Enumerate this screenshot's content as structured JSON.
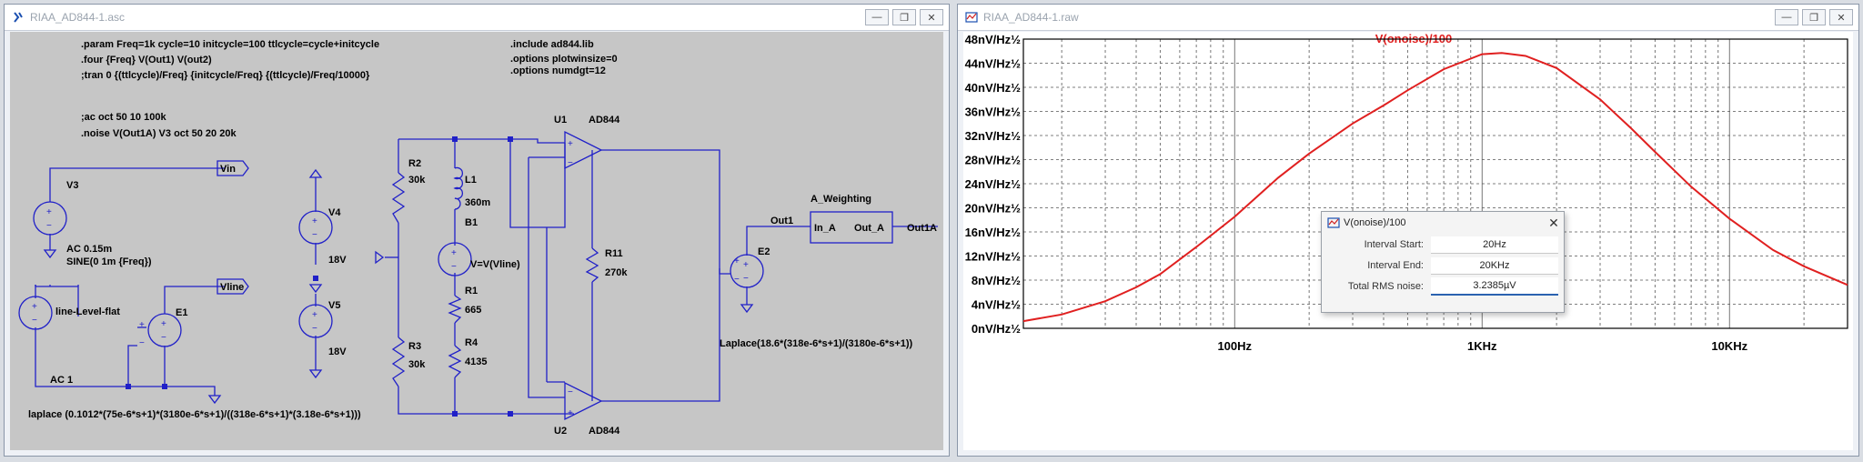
{
  "left_window": {
    "title": "RIAA_AD844-1.asc",
    "directives": [
      ".param Freq=1k cycle=10 initcycle=100 ttlcycle=cycle+initcycle",
      ".four {Freq} V(Out1) V(out2)",
      ";tran 0 {(ttlcycle)/Freq} {initcycle/Freq} {(ttlcycle)/Freq/10000}",
      ";ac oct 50 10 100k",
      ".noise V(Out1A) V3 oct 50 20 20k",
      ".include ad844.lib",
      ".options plotwinsize=0",
      ".options numdgt=12"
    ],
    "labels": {
      "v3": "V3",
      "v3_ac": "AC 0.15m",
      "v3_sine": "SINE(0 1m {Freq})",
      "vin": "Vin",
      "vline": "Vline",
      "src_name": "line-Level-flat",
      "src_ac": "AC 1",
      "e1": "E1",
      "v4": "V4",
      "v4_val": "18V",
      "v5": "V5",
      "v5_val": "18V",
      "r2": "R2",
      "r2_val": "30k",
      "r3": "R3",
      "r3_val": "30k",
      "l1": "L1",
      "l1_val": "360m",
      "b1": "B1",
      "b1_expr": "V=V(Vline)",
      "r1": "R1",
      "r1_val": "665",
      "r4": "R4",
      "r4_val": "4135",
      "r11": "R11",
      "r11_val": "270k",
      "u1": "U1",
      "u1_model": "AD844",
      "u2": "U2",
      "u2_model": "AD844",
      "out1": "Out1",
      "e2": "E2",
      "aw_title": "A_Weighting",
      "aw_in": "In_A",
      "aw_out": "Out_A",
      "out1a": "Out1A",
      "laplace_e1": "laplace (0.1012*(75e-6*s+1)*(3180e-6*s+1)/((318e-6*s+1)*(3.18e-6*s+1)))",
      "laplace_e2": "Laplace(18.6*(318e-6*s+1)/(3180e-6*s+1))"
    }
  },
  "right_window": {
    "title": "RIAA_AD844-1.raw"
  },
  "chart_data": {
    "type": "line",
    "title": "V(onoise)/100",
    "xlabel": "",
    "ylabel": "",
    "x_scale": "log",
    "xlim": [
      14,
      30000
    ],
    "ylim": [
      0,
      48
    ],
    "y_unit": "nV/Hz½",
    "grid": true,
    "x_tick_labels": [
      "100Hz",
      "1KHz",
      "10KHz"
    ],
    "y_tick_labels": [
      "0nV/Hz½",
      "4nV/Hz½",
      "8nV/Hz½",
      "12nV/Hz½",
      "16nV/Hz½",
      "20nV/Hz½",
      "24nV/Hz½",
      "28nV/Hz½",
      "32nV/Hz½",
      "36nV/Hz½",
      "40nV/Hz½",
      "44nV/Hz½",
      "48nV/Hz½"
    ],
    "series": [
      {
        "name": "V(onoise)/100",
        "color": "#e02020",
        "x": [
          14,
          20,
          30,
          40,
          50,
          70,
          100,
          150,
          200,
          300,
          400,
          500,
          700,
          1000,
          1200,
          1500,
          2000,
          3000,
          4000,
          5000,
          7000,
          10000,
          15000,
          20000,
          30000
        ],
        "y": [
          1.2,
          2.3,
          4.5,
          6.8,
          9.0,
          13.5,
          18.5,
          25.0,
          29.0,
          34.0,
          37.0,
          39.5,
          43.0,
          45.5,
          45.7,
          45.2,
          43.2,
          38.0,
          33.2,
          29.3,
          23.5,
          18.2,
          13.0,
          10.3,
          7.2
        ]
      }
    ]
  },
  "dialog": {
    "title": "V(onoise)/100",
    "interval_start_label": "Interval Start:",
    "interval_start": "20Hz",
    "interval_end_label": "Interval End:",
    "interval_end": "20KHz",
    "rms_label": "Total RMS noise:",
    "rms_value": "3.2385µV"
  },
  "colors": {
    "wire": "#2020c8",
    "trace": "#e02020",
    "schematic_bg": "#c6c6c6",
    "text": "#000000"
  }
}
